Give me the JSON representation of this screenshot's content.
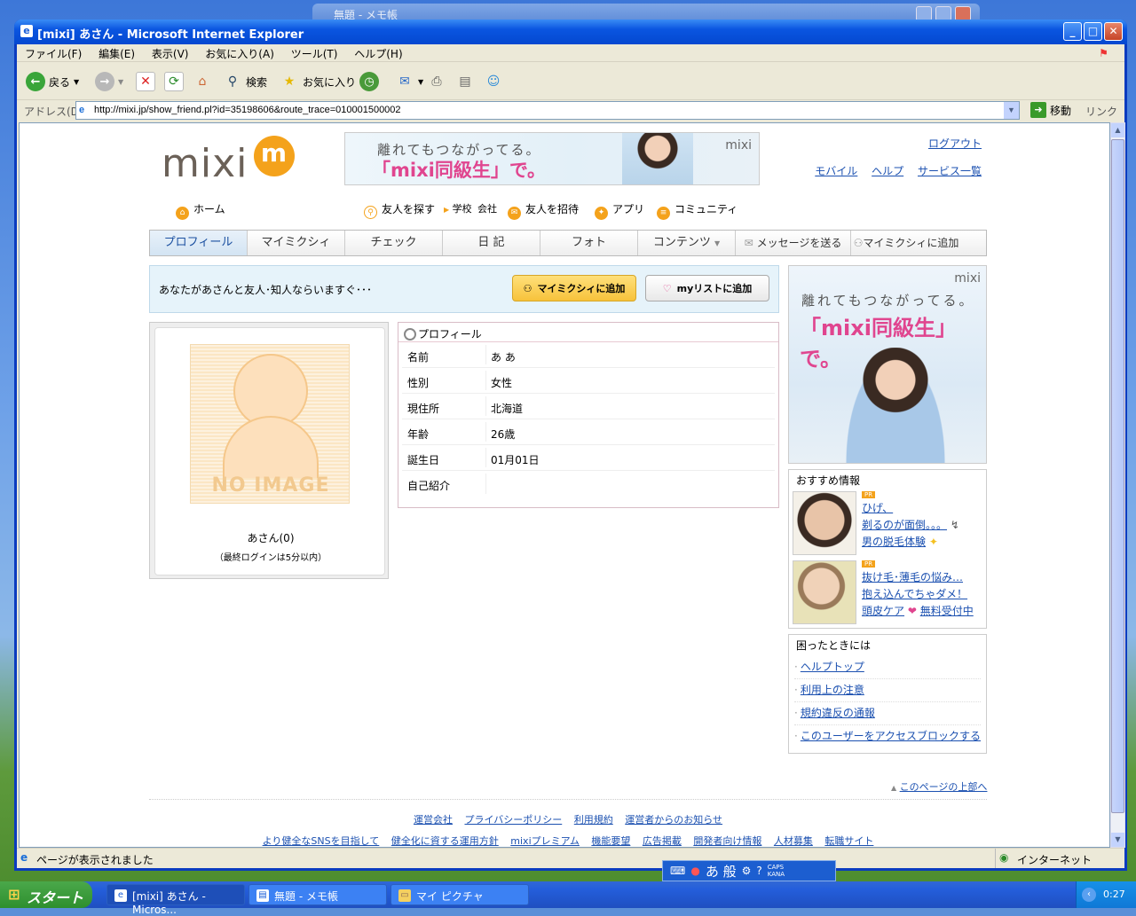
{
  "background_window": {
    "title": "無題 - メモ帳"
  },
  "window": {
    "title": "[mixi] あさん - Microsoft Internet Explorer"
  },
  "menu": [
    "ファイル(F)",
    "編集(E)",
    "表示(V)",
    "お気に入り(A)",
    "ツール(T)",
    "ヘルプ(H)"
  ],
  "toolbar": {
    "back": "戻る",
    "search": "検索",
    "favorites": "お気に入り"
  },
  "address": {
    "label": "アドレス(D)",
    "url": "http://mixi.jp/show_friend.pl?id=35198606&route_trace=010001500002",
    "go": "移動",
    "links": "リンク"
  },
  "header": {
    "logo": "mixi",
    "banner": {
      "line1": "離れてもつながってる。",
      "line2": "「mixi同級生」で。",
      "brand": "mixi"
    },
    "logout": "ログアウト",
    "links": [
      "モバイル",
      "ヘルプ",
      "サービス一覧"
    ]
  },
  "gnav": {
    "home": "ホーム",
    "find": "友人を探す",
    "school": "学校",
    "company": "会社",
    "invite": "友人を招待",
    "apps": "アプリ",
    "community": "コミュニティ"
  },
  "tabs": [
    "プロフィール",
    "マイミクシィ",
    "チェック",
    "日 記",
    "フォト",
    "コンテンツ",
    "メッセージを送る",
    "マイミクシィに追加"
  ],
  "action": {
    "message": "あなたがあさんと友人･知人ならいますぐ･･･",
    "add": "マイミクシィに追加",
    "mylist": "myリストに追加"
  },
  "photo": {
    "noimage": "NO IMAGE",
    "name": "あさん(0)",
    "login": "（最終ログインは5分以内）"
  },
  "profile": {
    "title": "プロフィール",
    "rows": [
      {
        "k": "名前",
        "v": "あ あ"
      },
      {
        "k": "性別",
        "v": "女性"
      },
      {
        "k": "現住所",
        "v": "北海道"
      },
      {
        "k": "年齢",
        "v": "26歳"
      },
      {
        "k": "誕生日",
        "v": "01月01日"
      },
      {
        "k": "自己紹介",
        "v": ""
      }
    ]
  },
  "side_ad": {
    "brand": "mixi",
    "line1": "離れてもつながってる。",
    "line2": "「mixi同級生」で。"
  },
  "recommend": {
    "title": "おすすめ情報",
    "pr": "PR",
    "items": [
      {
        "lines": [
          "ひげ、",
          "剃るのが面倒。。。",
          "男の脱毛体験"
        ]
      },
      {
        "lines": [
          "抜け毛･薄毛の悩み…",
          "抱え込んでちゃダメ！",
          "頭皮ケア",
          "無料受付中"
        ]
      }
    ]
  },
  "help": {
    "title": "困ったときには",
    "items": [
      "ヘルプトップ",
      "利用上の注意",
      "規約違反の通報",
      "このユーザーをアクセスブロックする"
    ]
  },
  "page_top": "このページの上部へ",
  "footer": {
    "row1": [
      "運営会社",
      "プライバシーポリシー",
      "利用規約",
      "運営者からのお知らせ"
    ],
    "row2": [
      "より健全なSNSを目指して",
      "健全化に資する運用方針",
      "mixiプレミアム",
      "機能要望",
      "広告掲載",
      "開発者向け情報",
      "人材募集",
      "転職サイト"
    ]
  },
  "status": {
    "text": "ページが表示されました",
    "zone": "インターネット"
  },
  "ime": {
    "mode": "あ 般",
    "caps": "CAPS",
    "kana": "KANA"
  },
  "taskbar": {
    "start": "スタート",
    "tasks": [
      "[mixi] あさん - Micros...",
      "無題 - メモ帳",
      "マイ ピクチャ"
    ],
    "clock": "0:27"
  }
}
